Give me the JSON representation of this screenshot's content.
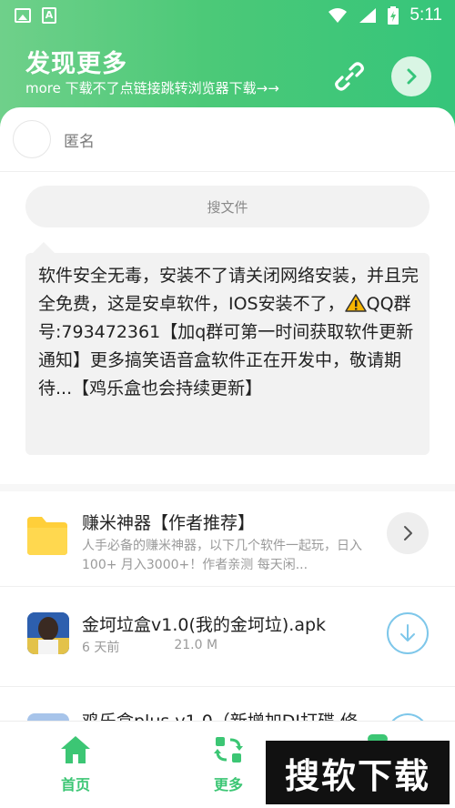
{
  "status_bar": {
    "time": "5:11"
  },
  "header": {
    "title": "发现更多",
    "subtitle": "more  下载不了点链接跳转浏览器下载→→"
  },
  "user": {
    "name": "匿名"
  },
  "search": {
    "label": "搜文件"
  },
  "notice": {
    "line_part1": "软件安全无毒，安装不了请关闭网络安装，并且完全免费，这是安卓软件，IOS安装不了，",
    "line_part2": "QQ群号:793472361【加q群可第一时间获取软件更新通知】更多搞笑语音盒软件正在开发中，敬请期待...【鸡乐盒也会持续更新】"
  },
  "items": [
    {
      "name": "赚米神器【作者推荐】",
      "desc": "人手必备的赚米神器，以下几个软件一起玩，日入100+ 月入3000+！作者亲测 每天闲..."
    },
    {
      "name": "金坷垃盒v1.0(我的金坷垃).apk",
      "time": "6 天前",
      "size": "21.0 M"
    },
    {
      "name": "鸡乐盒plus v1.0（新增加DJ打碟 修"
    }
  ],
  "bottom_nav": {
    "home": "首页",
    "more": "更多"
  },
  "watermark": "搜软下载",
  "colors": {
    "accent": "#3cc674",
    "header_start": "#6fd08a",
    "header_end": "#35c57a"
  }
}
